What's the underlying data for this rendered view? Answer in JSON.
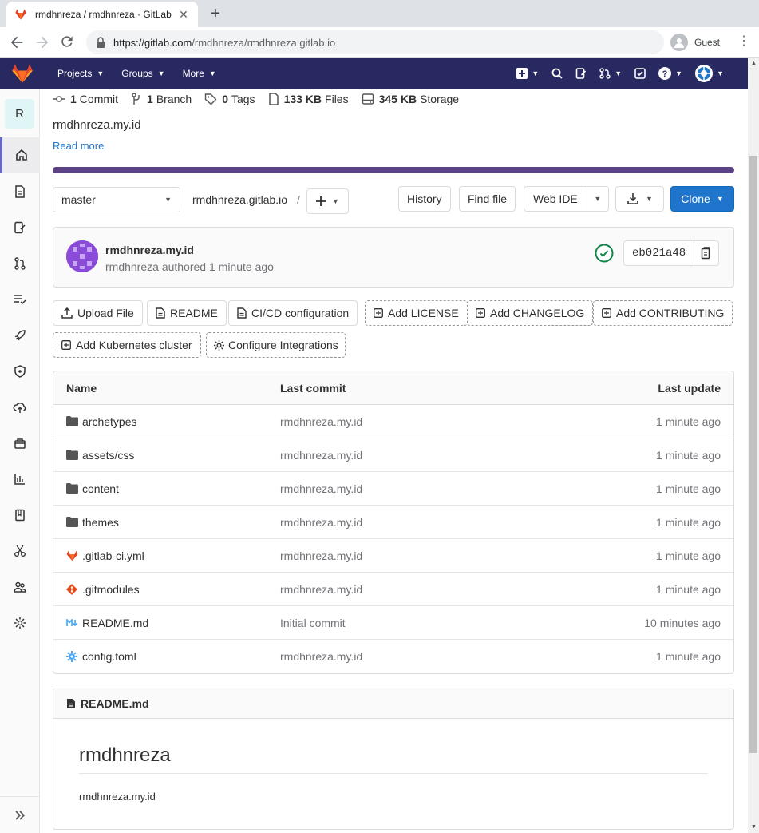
{
  "browser": {
    "tab_title": "rmdhnreza / rmdhnreza · GitLab",
    "tab_close": "✕",
    "new_tab": "+",
    "url_host": "https://gitlab.com",
    "url_path": "/rmdhnreza/rmdhnreza.gitlab.io",
    "profile_label": "Guest"
  },
  "topnav": {
    "projects": "Projects",
    "groups": "Groups",
    "more": "More"
  },
  "sidebar": {
    "project_initial": "R",
    "items": [
      "project-overview",
      "repository",
      "issues",
      "merge-requests",
      "ci-cd",
      "deployments",
      "security",
      "infrastructure",
      "packages",
      "analytics",
      "wiki",
      "snippets",
      "members",
      "settings"
    ]
  },
  "stats": {
    "commits_count": "1",
    "commits_label": "Commit",
    "branches_count": "1",
    "branches_label": "Branch",
    "tags_count": "0",
    "tags_label": "Tags",
    "files_size": "133 KB",
    "files_label": "Files",
    "storage_size": "345 KB",
    "storage_label": "Storage"
  },
  "project": {
    "description": "rmdhnreza.my.id",
    "read_more": "Read more",
    "accent_color": "#5b4285"
  },
  "toolbar": {
    "branch": "master",
    "path": "rmdhnreza.gitlab.io",
    "path_sep": "/",
    "history": "History",
    "find_file": "Find file",
    "web_ide": "Web IDE",
    "clone": "Clone"
  },
  "commit": {
    "title": "rmdhnreza.my.id",
    "author": "rmdhnreza",
    "action": "authored",
    "time": "1 minute ago",
    "sha": "eb021a48"
  },
  "actions": {
    "upload": "Upload File",
    "readme": "README",
    "cicd": "CI/CD configuration",
    "license": "Add LICENSE",
    "changelog": "Add CHANGELOG",
    "contributing": "Add CONTRIBUTING",
    "kubernetes": "Add Kubernetes cluster",
    "integrations": "Configure Integrations"
  },
  "files": {
    "headers": {
      "name": "Name",
      "last_commit": "Last commit",
      "last_update": "Last update"
    },
    "rows": [
      {
        "name": "archetypes",
        "icon": "folder-icon",
        "commit": "rmdhnreza.my.id",
        "updated": "1 minute ago"
      },
      {
        "name": "assets/css",
        "icon": "folder-icon",
        "commit": "rmdhnreza.my.id",
        "updated": "1 minute ago"
      },
      {
        "name": "content",
        "icon": "folder-icon",
        "commit": "rmdhnreza.my.id",
        "updated": "1 minute ago"
      },
      {
        "name": "themes",
        "icon": "folder-icon",
        "commit": "rmdhnreza.my.id",
        "updated": "1 minute ago"
      },
      {
        "name": ".gitlab-ci.yml",
        "icon": "gitlab-icon",
        "commit": "rmdhnreza.my.id",
        "updated": "1 minute ago"
      },
      {
        "name": ".gitmodules",
        "icon": "git-icon",
        "commit": "rmdhnreza.my.id",
        "updated": "1 minute ago"
      },
      {
        "name": "README.md",
        "icon": "markdown-icon",
        "commit": "Initial commit",
        "updated": "10 minutes ago"
      },
      {
        "name": "config.toml",
        "icon": "settings-file-icon",
        "commit": "rmdhnreza.my.id",
        "updated": "1 minute ago"
      }
    ]
  },
  "readme": {
    "filename": "README.md",
    "heading": "rmdhnreza",
    "body": "rmdhnreza.my.id"
  }
}
